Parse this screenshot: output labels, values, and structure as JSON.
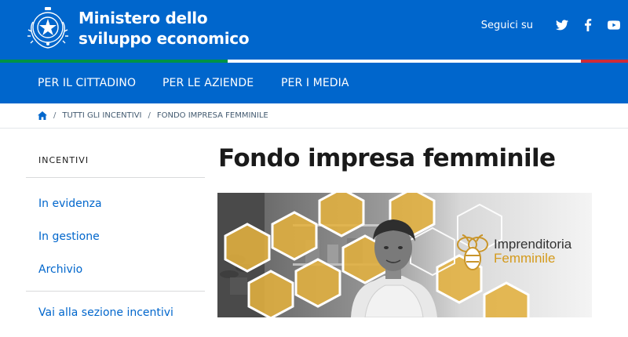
{
  "header": {
    "ministry_line1": "Ministero dello",
    "ministry_line2": "sviluppo economico",
    "follow_label": "Seguici su",
    "social_icons": [
      "twitter-icon",
      "facebook-icon",
      "youtube-icon"
    ]
  },
  "nav": {
    "items": [
      {
        "label": "PER IL CITTADINO"
      },
      {
        "label": "PER LE AZIENDE"
      },
      {
        "label": "PER I MEDIA"
      }
    ]
  },
  "breadcrumb": {
    "home_icon": "home-icon",
    "items": [
      "TUTTI GLI INCENTIVI",
      "FONDO IMPRESA FEMMINILE"
    ],
    "separator": "/"
  },
  "sidebar": {
    "title": "INCENTIVI",
    "items": [
      {
        "label": "In evidenza"
      },
      {
        "label": "In gestione"
      },
      {
        "label": "Archivio"
      }
    ],
    "footer_link": "Vai alla sezione incentivi"
  },
  "main": {
    "title": "Fondo impresa femminile",
    "banner": {
      "logo_line1": "Imprenditoria",
      "logo_line2": "Femminile",
      "logo_icon": "bee-icon"
    }
  },
  "colors": {
    "primary": "#0066cc",
    "flag_green": "#009246",
    "flag_red": "#ce2b37",
    "honey": "#e3b13f",
    "text_dark": "#1a1a1a"
  }
}
